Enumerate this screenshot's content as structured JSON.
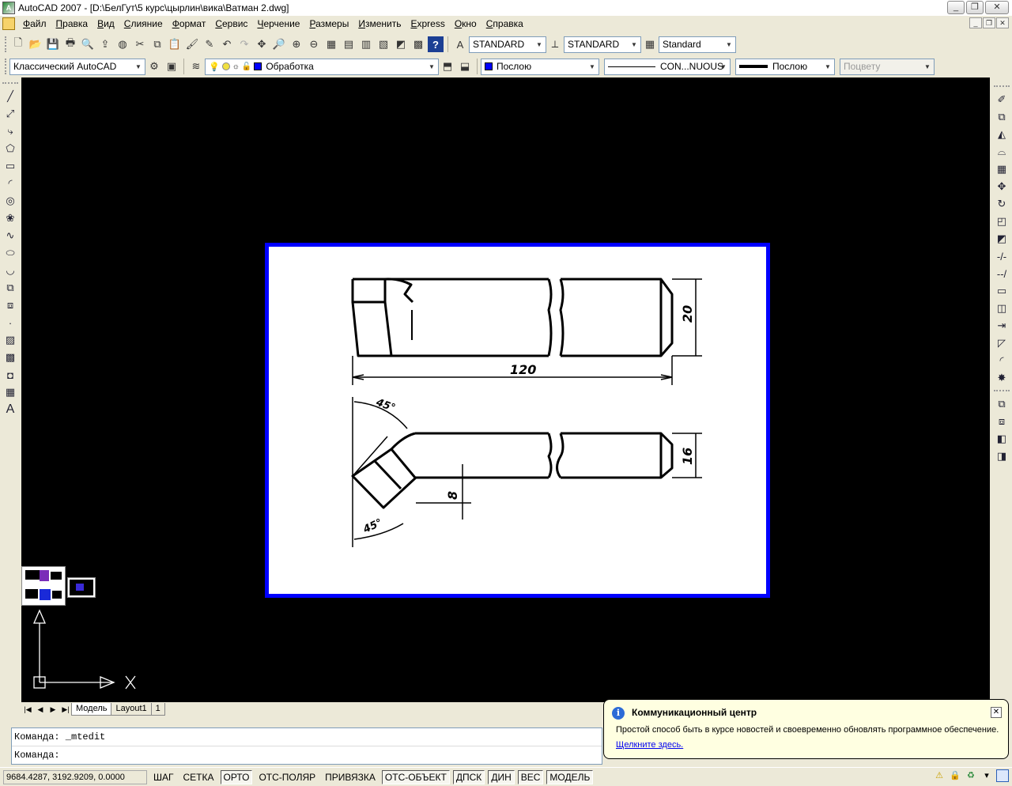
{
  "window": {
    "title": "AutoCAD 2007 - [D:\\БелГут\\5 курс\\цырлин\\вика\\Ватман 2.dwg]"
  },
  "menu": [
    "Файл",
    "Правка",
    "Вид",
    "Слияние",
    "Формат",
    "Сервис",
    "Черчение",
    "Размеры",
    "Изменить",
    "Express",
    "Окно",
    "Справка"
  ],
  "styles_toolbar": {
    "text_style": "STANDARD",
    "dim_style": "STANDARD",
    "table_style": "Standard"
  },
  "properties_toolbar": {
    "workspace": "Классический AutoCAD",
    "layer": "Обработка",
    "layer_color": "#0000ff",
    "color": "Послою",
    "linetype": "CON...NUOUS",
    "lineweight": "Послою",
    "plot_style": "Поцвету"
  },
  "drawing": {
    "dim_length": "120",
    "dim_height_top": "20",
    "dim_height_bottom": "16",
    "dim_small": "8",
    "angle_top": "45°",
    "angle_bottom": "45°",
    "frame_color": "#0000ff"
  },
  "layout_tabs": [
    "Модель",
    "Layout1",
    "1"
  ],
  "command_lines": [
    "Команда:  _mtedit",
    "Команда:"
  ],
  "status": {
    "coords": "9684.4287, 3192.9209, 0.0000",
    "buttons": [
      {
        "label": "ШАГ",
        "on": false
      },
      {
        "label": "СЕТКА",
        "on": false
      },
      {
        "label": "ОРТО",
        "on": true
      },
      {
        "label": "ОТС-ПОЛЯР",
        "on": false
      },
      {
        "label": "ПРИВЯЗКА",
        "on": false
      },
      {
        "label": "ОТС-ОБЪЕКТ",
        "on": true
      },
      {
        "label": "ДПСК",
        "on": true
      },
      {
        "label": "ДИН",
        "on": true
      },
      {
        "label": "ВЕС",
        "on": true
      },
      {
        "label": "МОДЕЛЬ",
        "on": true
      }
    ]
  },
  "balloon": {
    "title": "Коммуникационный центр",
    "text": "Простой способ быть в курсе новостей и своевременно обновлять программное обеспечение.",
    "link": "Щелкните здесь."
  },
  "ucs": {
    "x_label": "X"
  }
}
